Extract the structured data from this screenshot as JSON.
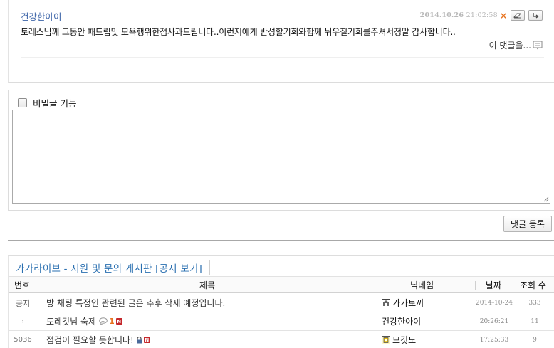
{
  "comment": {
    "author": "건강한아이",
    "date": "2014.10.26",
    "time": "21:02:58",
    "delete_icon": "×",
    "text": "토레스님께 그동안 패드립및 모욕행위한점사과드립니다..이런저에게 반성할기회와함께 뉘우칠기회를주셔서정말 감사합니다..",
    "reply_label": "이 댓글을..."
  },
  "form": {
    "secret_label": "비밀글 기능",
    "submit_label": "댓글 등록"
  },
  "board": {
    "title": "가가라이브 - 지원 및 문의 게시판 [공지 보기]",
    "headers": {
      "number": "번호",
      "subject": "제목",
      "nickname": "닉네임",
      "date": "날짜",
      "views": "조회 수"
    },
    "rows": [
      {
        "number": "공지",
        "subject": "방 채팅 특정인 관련된 글은 추후 삭제 예정입니다.",
        "nickname": "가가토끼",
        "date": "2014-10-24",
        "views": "333"
      },
      {
        "number": "",
        "subject": "토레갓님 숙제",
        "comment_count": "1",
        "nickname": "건강한아이",
        "date": "20:26:21",
        "views": "11"
      },
      {
        "number": "5036",
        "subject": "점검이 필요할 듯합니다!",
        "nickname": "므깃도",
        "date": "17:25:33",
        "views": "9"
      }
    ]
  },
  "colors": {
    "accent_blue": "#2a6fb0",
    "author_blue": "#3c64a8",
    "comment_orange": "#e8731f",
    "new_badge_red": "#c4282c"
  },
  "icons": {
    "delete": "close-icon",
    "edit": "eraser-icon",
    "reply": "reply-arrow-icon",
    "comment_reply": "memo-icon",
    "new_badge": "new-badge-icon",
    "lock": "lock-icon",
    "comment_bubble": "speech-bubble-icon"
  }
}
